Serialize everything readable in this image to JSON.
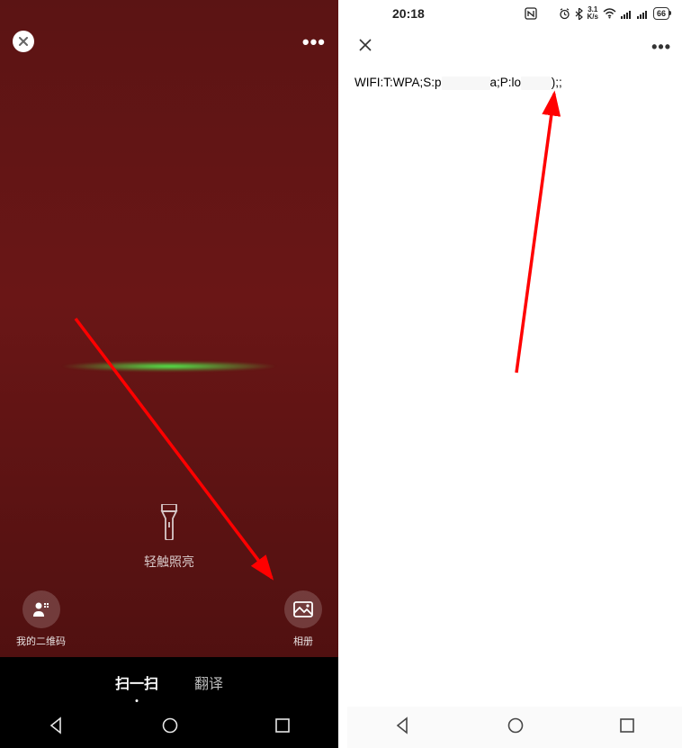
{
  "left": {
    "flashlight_label": "轻触照亮",
    "qr_label": "我的二维码",
    "album_label": "相册",
    "tabs": {
      "scan": "扫一扫",
      "translate": "翻译"
    }
  },
  "right": {
    "status": {
      "time": "20:18",
      "speed_top": "3.1",
      "speed_bottom": "K/s",
      "battery": "66"
    },
    "wifi_prefix": "WIFI:T:WPA;S:p",
    "wifi_mid": "a;P:l",
    "wifi_suffix1": "o",
    "wifi_suffix2": ");;",
    "redact_ssid": "xxxxxxxx",
    "redact_pwd": "xxxxx"
  },
  "icons": {
    "close": "close-icon",
    "more": "more-icon",
    "flashlight": "flashlight-icon",
    "qr_person": "my-qr-icon",
    "album": "album-icon",
    "back": "back-icon",
    "home": "home-icon",
    "recent": "recent-icon",
    "nfc": "nfc-icon",
    "alarm": "alarm-icon",
    "bluetooth": "bluetooth-icon",
    "wifi": "wifi-icon",
    "signal": "signal-icon",
    "close_x": "close-x-icon"
  }
}
